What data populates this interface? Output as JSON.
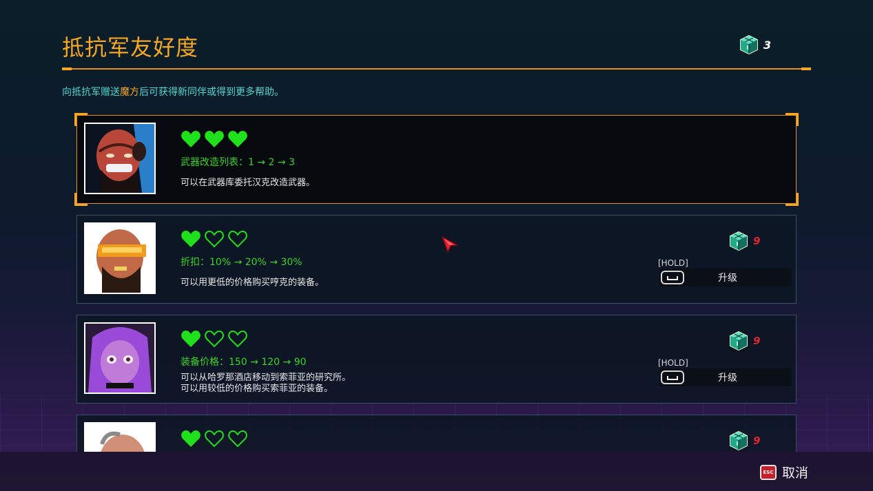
{
  "header": {
    "title": "抵抗军友好度",
    "currency_count": "3",
    "subtitle_pre": "向抵抗军赠送",
    "subtitle_highlight": "魔方",
    "subtitle_post": "后可获得新同伴或得到更多帮助。"
  },
  "allies": [
    {
      "hearts_filled": 3,
      "hearts_total": 3,
      "perk": "武器改造列表：1 → 2 → 3",
      "desc": "可以在武器库委托汉克改造武器。",
      "selected": true
    },
    {
      "hearts_filled": 1,
      "hearts_total": 3,
      "perk": "折扣：10% → 20% → 30%",
      "desc": "可以用更低的价格购买哼克的装备。",
      "cost": "9",
      "hold": "[HOLD]",
      "upgrade": "升级"
    },
    {
      "hearts_filled": 1,
      "hearts_total": 3,
      "perk": "装备价格：150 → 120 → 90",
      "desc_line1": "可以从哈罗那酒店移动到索菲亚的研究所。",
      "desc_line2": "可以用较低的价格购买索菲亚的装备。",
      "cost": "9",
      "hold": "[HOLD]",
      "upgrade": "升级"
    },
    {
      "hearts_filled": 1,
      "hearts_total": 3,
      "cost": "9"
    }
  ],
  "footer": {
    "esc_key": "ESC",
    "cancel_label": "取消"
  },
  "colors": {
    "accent_orange": "#f5a623",
    "heart_green": "#1fe01a",
    "perk_green": "#39d42a",
    "subtitle_cyan": "#4fd8d2",
    "cost_red": "#e0262e"
  },
  "icons": [
    "cube-currency-icon",
    "heart-full-icon",
    "heart-empty-icon",
    "space-key-icon",
    "esc-key-icon",
    "mouse-cursor-icon"
  ]
}
